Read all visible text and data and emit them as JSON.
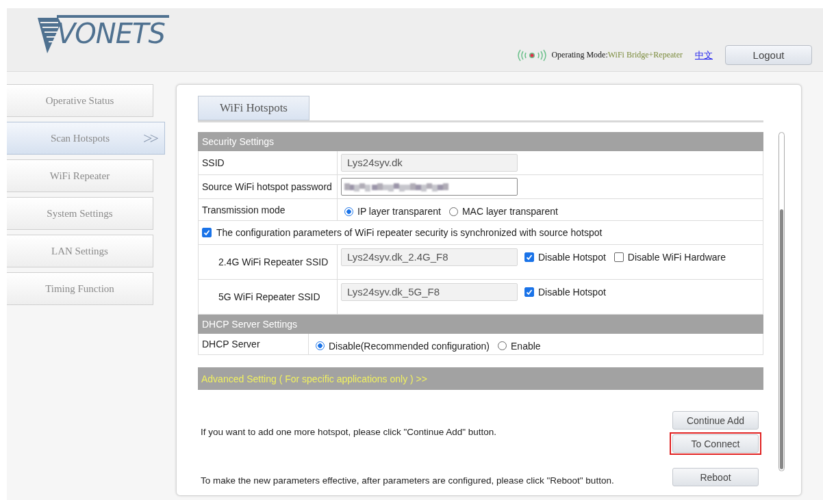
{
  "header": {
    "logo": "VONETS",
    "operating_mode_label": "Operating Mode:",
    "operating_mode_value": "WiFi Bridge+Repeater",
    "language_link": "中文",
    "logout_button": "Logout"
  },
  "sidebar": {
    "items": [
      {
        "label": "Operative Status",
        "selected": false
      },
      {
        "label": "Scan Hotspots",
        "selected": true,
        "arrow": ">>"
      },
      {
        "label": "WiFi Repeater",
        "selected": false
      },
      {
        "label": "System Settings",
        "selected": false
      },
      {
        "label": "LAN Settings",
        "selected": false
      },
      {
        "label": "Timing Function",
        "selected": false
      }
    ]
  },
  "tabs": [
    {
      "label": "WiFi Hotspots",
      "selected": true
    }
  ],
  "sections": [
    {
      "title": "Security Settings",
      "rows": [
        {
          "kind": "text",
          "label": "SSID",
          "value": "Lys24syv.dk"
        },
        {
          "kind": "password",
          "label": "Source WiFi hotspot password"
        },
        {
          "kind": "radio",
          "label": "Transmission mode",
          "options": [
            {
              "label": "IP layer transparent",
              "selected": true
            },
            {
              "label": "MAC layer transparent",
              "selected": false
            }
          ]
        },
        {
          "kind": "sync",
          "label": "The configuration parameters of WiFi repeater security is synchronized with source hotspot",
          "checked": true
        },
        {
          "kind": "repeater",
          "label": "2.4G WiFi Repeater SSID",
          "value": "Lys24syv.dk_2.4G_F8",
          "checks": [
            {
              "label": "Disable Hotspot",
              "checked": true
            },
            {
              "label": "Disable WiFi Hardware",
              "checked": false
            }
          ]
        },
        {
          "kind": "repeater",
          "label": "5G WiFi Repeater SSID",
          "value": "Lys24syv.dk_5G_F8",
          "checks": [
            {
              "label": "Disable Hotspot",
              "checked": true
            }
          ]
        }
      ]
    },
    {
      "title": "DHCP Server Settings",
      "rows": [
        {
          "kind": "radio",
          "label": "DHCP Server",
          "options": [
            {
              "label": "Disable(Recommended configuration)",
              "selected": true
            },
            {
              "label": "Enable",
              "selected": false
            }
          ]
        }
      ]
    }
  ],
  "advanced": {
    "label": "Advanced Setting ( For specific applications only ) >>"
  },
  "actions": [
    {
      "text": "If you want to add one more hotspot, please click \"Continue Add\" button.",
      "buttons": [
        {
          "label": "Continue Add",
          "highlighted": false
        },
        {
          "label": "To Connect",
          "highlighted": true
        }
      ]
    },
    {
      "text": "To make the new parameters effective, after parameters are configured, please click \"Reboot\" button.",
      "buttons": [
        {
          "label": "Reboot",
          "highlighted": false
        }
      ]
    }
  ]
}
